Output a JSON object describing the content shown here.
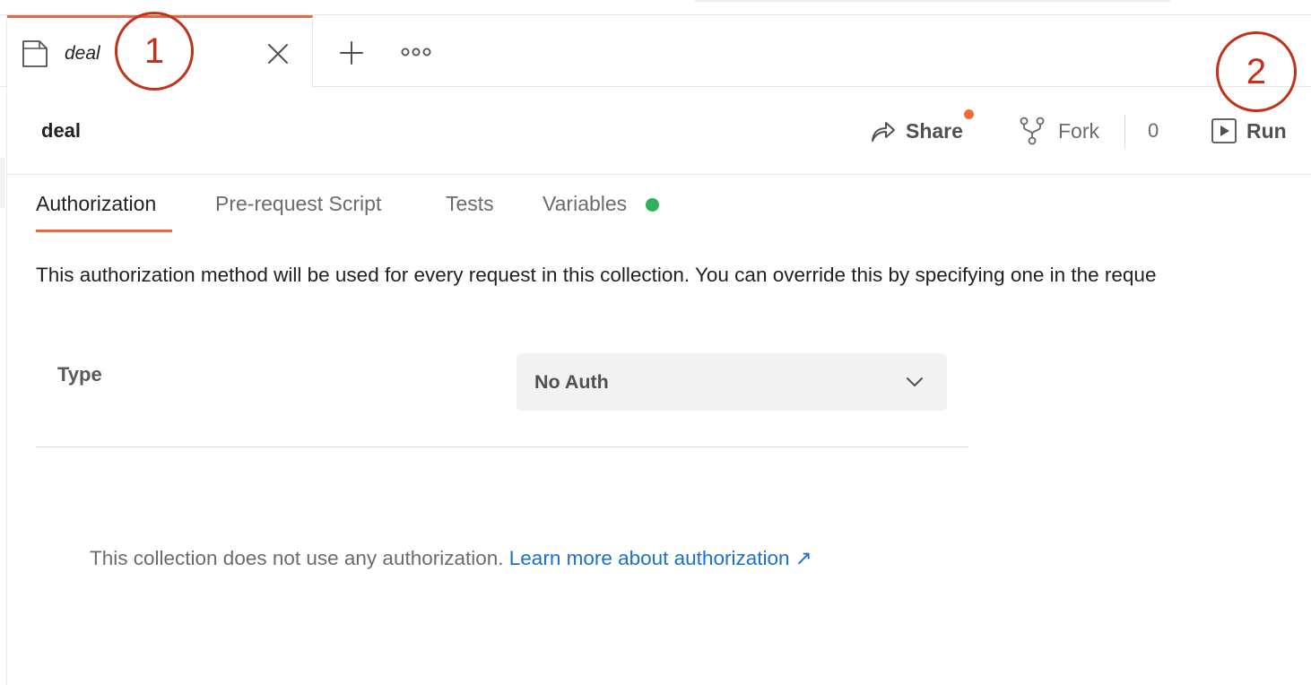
{
  "tab": {
    "label": "deal",
    "icon": "collection-icon"
  },
  "header": {
    "title": "deal",
    "share_label": "Share",
    "fork_label": "Fork",
    "fork_count": "0",
    "run_label": "Run"
  },
  "subtabs": [
    {
      "label": "Authorization",
      "active": true
    },
    {
      "label": "Pre-request Script",
      "active": false
    },
    {
      "label": "Tests",
      "active": false
    },
    {
      "label": "Variables",
      "active": false,
      "status_dot_color": "#2fb15b"
    }
  ],
  "auth": {
    "description": "This authorization method will be used for every request in this collection. You can override this by specifying one in the reque",
    "type_label": "Type",
    "type_value": "No Auth",
    "no_auth_message": "This collection does not use any authorization.",
    "learn_more_link": "Learn more about authorization ↗"
  },
  "annotations": [
    {
      "label": "1"
    },
    {
      "label": "2"
    }
  ],
  "colors": {
    "accent": "#e8683f",
    "link": "#1a6fcf",
    "annotation": "#c2321a"
  }
}
